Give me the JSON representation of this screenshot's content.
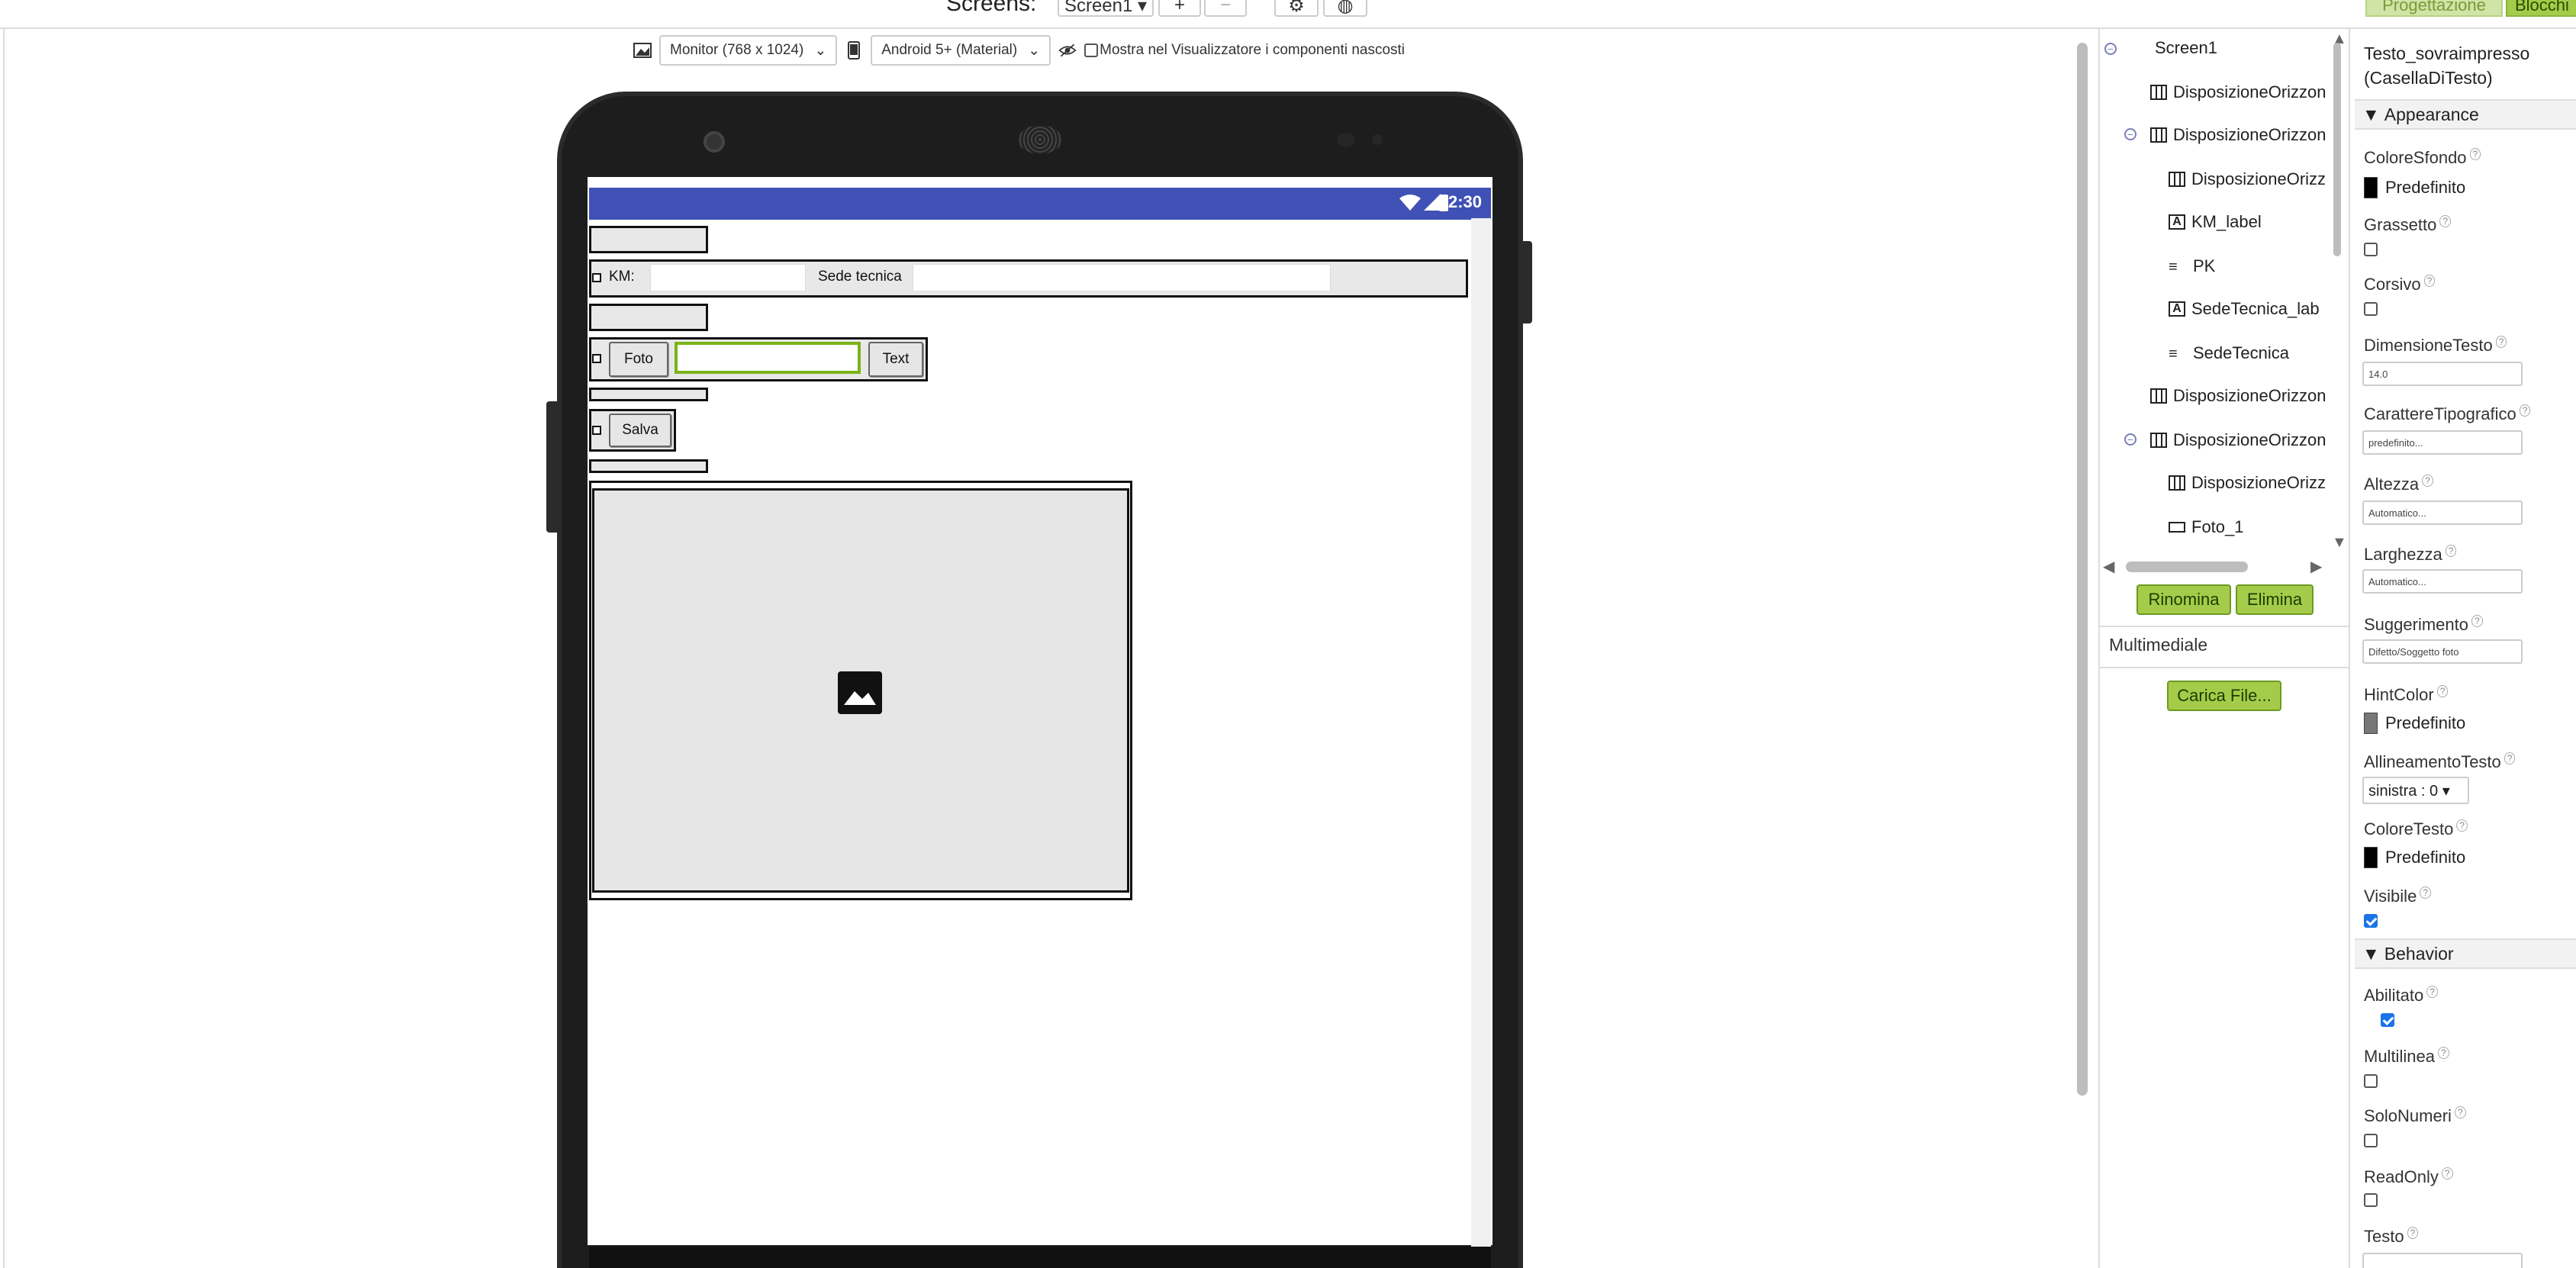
{
  "topbar": {
    "screens_label": "Screens:",
    "screen_select": "Screen1 ▾",
    "add": "+",
    "remove": "−",
    "designer": "Progettazione",
    "blocks": "Blocchi"
  },
  "viewer": {
    "device_select": "Monitor (768 x 1024)",
    "theme_select": "Android 5+ (Material)",
    "hidden_label": "Mostra nel Visualizzatore i componenti nascosti"
  },
  "phone": {
    "time": "12:30",
    "km_label": "KM:",
    "sede_label": "Sede tecnica",
    "foto_button": "Foto",
    "text_button": "Text",
    "salva_button": "Salva"
  },
  "components": {
    "items": [
      {
        "label": "Screen1",
        "icon": "screen-icon"
      },
      {
        "label": "DisposizioneOrizzon",
        "icon": "horizontal-arrangement-icon"
      },
      {
        "label": "DisposizioneOrizzon",
        "icon": "horizontal-arrangement-icon"
      },
      {
        "label": "DisposizioneOrizz",
        "icon": "horizontal-arrangement-icon"
      },
      {
        "label": "KM_label",
        "icon": "label-icon"
      },
      {
        "label": "PK",
        "icon": "textbox-icon"
      },
      {
        "label": "SedeTecnica_lab",
        "icon": "label-icon"
      },
      {
        "label": "SedeTecnica",
        "icon": "textbox-icon"
      },
      {
        "label": "DisposizioneOrizzon",
        "icon": "horizontal-arrangement-icon"
      },
      {
        "label": "DisposizioneOrizzon",
        "icon": "horizontal-arrangement-icon"
      },
      {
        "label": "DisposizioneOrizz",
        "icon": "horizontal-arrangement-icon"
      },
      {
        "label": "Foto_1",
        "icon": "button-icon"
      }
    ],
    "rename": "Rinomina",
    "delete": "Elimina",
    "media_title": "Multimediale",
    "upload": "Carica File..."
  },
  "properties": {
    "title": "Testo_sovraimpresso (CasellaDiTesto)",
    "appearance": "Appearance",
    "behavior": "Behavior",
    "bg_color_label": "ColoreSfondo",
    "bg_color_value": "Predefinito",
    "bold_label": "Grassetto",
    "italic_label": "Corsivo",
    "font_size_label": "DimensioneTesto",
    "font_size_value": "14.0",
    "typeface_label": "CarattereTipografico",
    "typeface_value": "predefinito...",
    "height_label": "Altezza",
    "height_value": "Automatico...",
    "width_label": "Larghezza",
    "width_value": "Automatico...",
    "hint_label": "Suggerimento",
    "hint_value": "Difetto/Soggetto foto",
    "hint_color_label": "HintColor",
    "hint_color_value": "Predefinito",
    "align_label": "AllineamentoTesto",
    "align_value": "sinistra : 0 ▾",
    "text_color_label": "ColoreTesto",
    "text_color_value": "Predefinito",
    "visible_label": "Visibile",
    "enabled_label": "Abilitato",
    "multiline_label": "Multilinea",
    "numbers_label": "SoloNumeri",
    "readonly_label": "ReadOnly",
    "text_label": "Testo"
  },
  "colors": {
    "accent_green": "#a4cc4a",
    "status_bar": "#3f51b5",
    "focus_border": "#7ab317"
  }
}
